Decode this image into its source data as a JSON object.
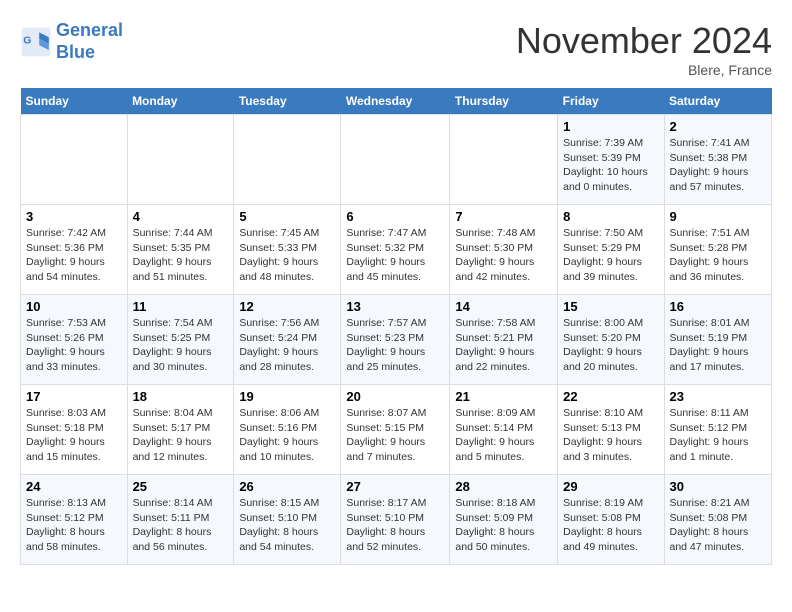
{
  "header": {
    "logo_line1": "General",
    "logo_line2": "Blue",
    "month": "November 2024",
    "location": "Blere, France"
  },
  "weekdays": [
    "Sunday",
    "Monday",
    "Tuesday",
    "Wednesday",
    "Thursday",
    "Friday",
    "Saturday"
  ],
  "weeks": [
    [
      {
        "day": "",
        "info": ""
      },
      {
        "day": "",
        "info": ""
      },
      {
        "day": "",
        "info": ""
      },
      {
        "day": "",
        "info": ""
      },
      {
        "day": "",
        "info": ""
      },
      {
        "day": "1",
        "info": "Sunrise: 7:39 AM\nSunset: 5:39 PM\nDaylight: 10 hours\nand 0 minutes."
      },
      {
        "day": "2",
        "info": "Sunrise: 7:41 AM\nSunset: 5:38 PM\nDaylight: 9 hours\nand 57 minutes."
      }
    ],
    [
      {
        "day": "3",
        "info": "Sunrise: 7:42 AM\nSunset: 5:36 PM\nDaylight: 9 hours\nand 54 minutes."
      },
      {
        "day": "4",
        "info": "Sunrise: 7:44 AM\nSunset: 5:35 PM\nDaylight: 9 hours\nand 51 minutes."
      },
      {
        "day": "5",
        "info": "Sunrise: 7:45 AM\nSunset: 5:33 PM\nDaylight: 9 hours\nand 48 minutes."
      },
      {
        "day": "6",
        "info": "Sunrise: 7:47 AM\nSunset: 5:32 PM\nDaylight: 9 hours\nand 45 minutes."
      },
      {
        "day": "7",
        "info": "Sunrise: 7:48 AM\nSunset: 5:30 PM\nDaylight: 9 hours\nand 42 minutes."
      },
      {
        "day": "8",
        "info": "Sunrise: 7:50 AM\nSunset: 5:29 PM\nDaylight: 9 hours\nand 39 minutes."
      },
      {
        "day": "9",
        "info": "Sunrise: 7:51 AM\nSunset: 5:28 PM\nDaylight: 9 hours\nand 36 minutes."
      }
    ],
    [
      {
        "day": "10",
        "info": "Sunrise: 7:53 AM\nSunset: 5:26 PM\nDaylight: 9 hours\nand 33 minutes."
      },
      {
        "day": "11",
        "info": "Sunrise: 7:54 AM\nSunset: 5:25 PM\nDaylight: 9 hours\nand 30 minutes."
      },
      {
        "day": "12",
        "info": "Sunrise: 7:56 AM\nSunset: 5:24 PM\nDaylight: 9 hours\nand 28 minutes."
      },
      {
        "day": "13",
        "info": "Sunrise: 7:57 AM\nSunset: 5:23 PM\nDaylight: 9 hours\nand 25 minutes."
      },
      {
        "day": "14",
        "info": "Sunrise: 7:58 AM\nSunset: 5:21 PM\nDaylight: 9 hours\nand 22 minutes."
      },
      {
        "day": "15",
        "info": "Sunrise: 8:00 AM\nSunset: 5:20 PM\nDaylight: 9 hours\nand 20 minutes."
      },
      {
        "day": "16",
        "info": "Sunrise: 8:01 AM\nSunset: 5:19 PM\nDaylight: 9 hours\nand 17 minutes."
      }
    ],
    [
      {
        "day": "17",
        "info": "Sunrise: 8:03 AM\nSunset: 5:18 PM\nDaylight: 9 hours\nand 15 minutes."
      },
      {
        "day": "18",
        "info": "Sunrise: 8:04 AM\nSunset: 5:17 PM\nDaylight: 9 hours\nand 12 minutes."
      },
      {
        "day": "19",
        "info": "Sunrise: 8:06 AM\nSunset: 5:16 PM\nDaylight: 9 hours\nand 10 minutes."
      },
      {
        "day": "20",
        "info": "Sunrise: 8:07 AM\nSunset: 5:15 PM\nDaylight: 9 hours\nand 7 minutes."
      },
      {
        "day": "21",
        "info": "Sunrise: 8:09 AM\nSunset: 5:14 PM\nDaylight: 9 hours\nand 5 minutes."
      },
      {
        "day": "22",
        "info": "Sunrise: 8:10 AM\nSunset: 5:13 PM\nDaylight: 9 hours\nand 3 minutes."
      },
      {
        "day": "23",
        "info": "Sunrise: 8:11 AM\nSunset: 5:12 PM\nDaylight: 9 hours\nand 1 minute."
      }
    ],
    [
      {
        "day": "24",
        "info": "Sunrise: 8:13 AM\nSunset: 5:12 PM\nDaylight: 8 hours\nand 58 minutes."
      },
      {
        "day": "25",
        "info": "Sunrise: 8:14 AM\nSunset: 5:11 PM\nDaylight: 8 hours\nand 56 minutes."
      },
      {
        "day": "26",
        "info": "Sunrise: 8:15 AM\nSunset: 5:10 PM\nDaylight: 8 hours\nand 54 minutes."
      },
      {
        "day": "27",
        "info": "Sunrise: 8:17 AM\nSunset: 5:10 PM\nDaylight: 8 hours\nand 52 minutes."
      },
      {
        "day": "28",
        "info": "Sunrise: 8:18 AM\nSunset: 5:09 PM\nDaylight: 8 hours\nand 50 minutes."
      },
      {
        "day": "29",
        "info": "Sunrise: 8:19 AM\nSunset: 5:08 PM\nDaylight: 8 hours\nand 49 minutes."
      },
      {
        "day": "30",
        "info": "Sunrise: 8:21 AM\nSunset: 5:08 PM\nDaylight: 8 hours\nand 47 minutes."
      }
    ]
  ]
}
